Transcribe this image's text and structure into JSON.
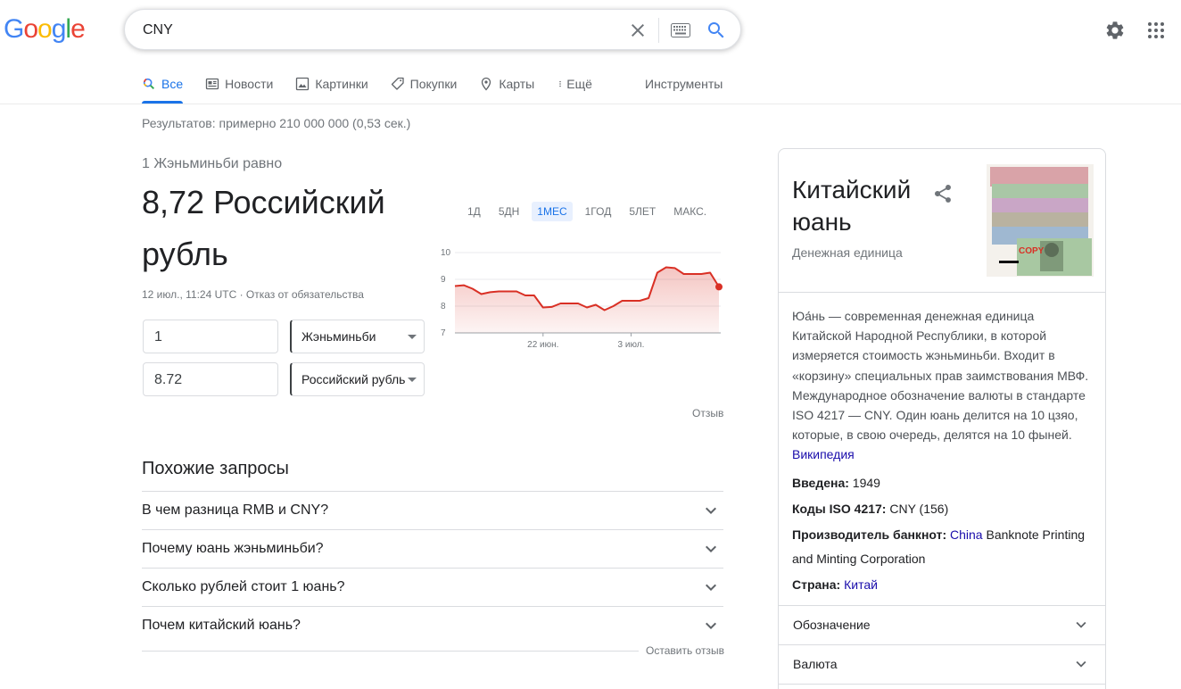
{
  "logo": {
    "letters": [
      "G",
      "o",
      "o",
      "g",
      "l",
      "e"
    ],
    "colors": [
      "#4285F4",
      "#EA4335",
      "#FBBC05",
      "#4285F4",
      "#34A853",
      "#EA4335"
    ]
  },
  "search": {
    "value": "CNY"
  },
  "tabs": [
    {
      "label": "Все",
      "icon": "search-icon",
      "active": true
    },
    {
      "label": "Новости",
      "icon": "news-icon"
    },
    {
      "label": "Картинки",
      "icon": "image-icon"
    },
    {
      "label": "Покупки",
      "icon": "tag-icon"
    },
    {
      "label": "Карты",
      "icon": "map-pin-icon"
    },
    {
      "label": "Ещё",
      "icon": "more-vert-icon"
    }
  ],
  "tools_label": "Инструменты",
  "result_stats": "Результатов: примерно 210 000 000 (0,53 сек.)",
  "converter": {
    "equals": "1 Жэньминьби равно",
    "result": "8,72 Российский рубль",
    "date": "12 июл., 11:24 UTC · Отказ от обязательства",
    "amount_from": "1",
    "currency_from": "Жэньминьби",
    "amount_to": "8.72",
    "currency_to": "Российский рубль",
    "ranges": [
      "1Д",
      "5ДН",
      "1МЕС",
      "1ГОД",
      "5ЛЕТ",
      "МАКС."
    ],
    "active_range": "1МЕС",
    "feedback": "Отзыв"
  },
  "chart_data": {
    "type": "area",
    "y_ticks": [
      "10",
      "9",
      "8",
      "7"
    ],
    "x_ticks": [
      "22 июн.",
      "3 июл."
    ],
    "ylim": [
      7,
      10
    ],
    "values": [
      8.75,
      8.78,
      8.65,
      8.45,
      8.52,
      8.55,
      8.55,
      8.55,
      8.4,
      8.4,
      7.95,
      7.97,
      8.1,
      8.1,
      8.1,
      7.95,
      8.05,
      7.85,
      8.0,
      8.2,
      8.2,
      8.2,
      8.3,
      9.25,
      9.45,
      9.42,
      9.2,
      9.2,
      9.2,
      9.25,
      8.72
    ],
    "color": "#d93025"
  },
  "related": {
    "title": "Похожие запросы",
    "items": [
      "В чем разница RMB и CNY?",
      "Почему юань жэньминьби?",
      "Сколько рублей стоит 1 юань?",
      "Почем китайский юань?"
    ],
    "leave_feedback": "Оставить отзыв"
  },
  "kp": {
    "title": "Китайский юань",
    "subtitle": "Денежная единица",
    "description": "Юа́нь — современная денежная единица Китайской Народной Республики, в которой измеряется стоимость жэньминьби. Входит в «корзину» специальных прав заимствования МВФ. Международное обозначение валюты в стандарте ISO 4217 — CNY. Один юань делится на 10 цзяо, которые, в свою очередь, делятся на 10 фыней.",
    "wiki": "Википедия",
    "facts": [
      {
        "label": "Введена:",
        "value": "1949"
      },
      {
        "label": "Коды ISO 4217:",
        "value": "CNY (156)"
      },
      {
        "label": "Производитель банкнот:",
        "link": "China",
        "value": " Banknote Printing and Minting Corporation"
      },
      {
        "label": "Страна:",
        "link": "Китай"
      }
    ],
    "image_stamp": "COPY",
    "accordions": [
      "Обозначение",
      "Валюта"
    ]
  }
}
